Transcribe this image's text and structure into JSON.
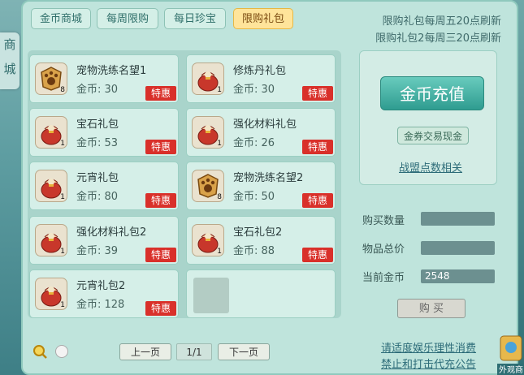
{
  "tabs": [
    "金币商城",
    "每周限购",
    "每日珍宝",
    "限购礼包"
  ],
  "active_tab_index": 3,
  "notices": [
    "限购礼包每周五20点刷新",
    "限购礼包2每周三20点刷新"
  ],
  "side_label": [
    "商",
    "城"
  ],
  "bottom_right_fragment": "外观商",
  "price_prefix": "金币: ",
  "tag_label": "特惠",
  "items": [
    {
      "name": "宠物洗练名望1",
      "price": "30",
      "count": "8",
      "icon": "paw-badge-icon"
    },
    {
      "name": "修炼丹礼包",
      "price": "30",
      "count": "1",
      "icon": "gift-bag-icon"
    },
    {
      "name": "宝石礼包",
      "price": "53",
      "count": "1",
      "icon": "gift-bag-icon"
    },
    {
      "name": "强化材料礼包",
      "price": "26",
      "count": "1",
      "icon": "gift-bag-icon"
    },
    {
      "name": "元宵礼包",
      "price": "80",
      "count": "1",
      "icon": "gift-bag-icon"
    },
    {
      "name": "宠物洗练名望2",
      "price": "50",
      "count": "8",
      "icon": "paw-badge-icon"
    },
    {
      "name": "强化材料礼包2",
      "price": "39",
      "count": "1",
      "icon": "gift-bag-icon"
    },
    {
      "name": "宝石礼包2",
      "price": "88",
      "count": "1",
      "icon": "gift-bag-icon"
    },
    {
      "name": "元宵礼包2",
      "price": "128",
      "count": "1",
      "icon": "gift-bag-icon"
    }
  ],
  "right": {
    "recharge_label": "金币充值",
    "exchange_label": "金券交易现金",
    "guild_link": "战盟点数相关",
    "qty_label": "购买数量",
    "qty_value": "",
    "total_label": "物品总价",
    "total_value": "",
    "gold_label": "当前金币",
    "gold_value": "2548",
    "buy_label": "购 买"
  },
  "pager": {
    "prev": "上一页",
    "page": "1/1",
    "next": "下一页"
  },
  "footer": [
    "请适度娱乐理性消费",
    "禁止和打击代充公告"
  ],
  "colors": {
    "panel": "#bfe4dc",
    "tag_red": "#d9302a",
    "active_tab": "#ffe49a",
    "accent_teal": "#2f9c90"
  }
}
